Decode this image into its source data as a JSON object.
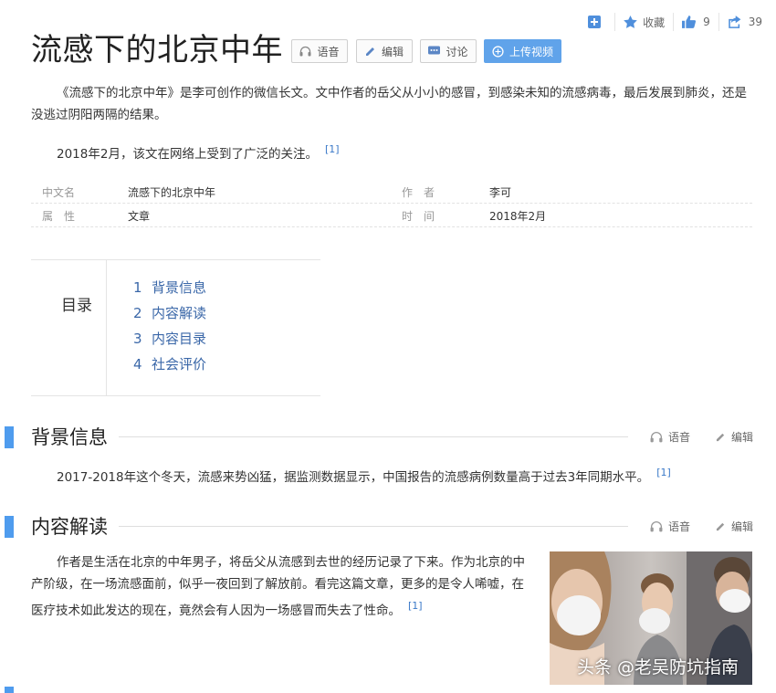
{
  "toolbar": {
    "collect_label": "收藏",
    "like_count": "9",
    "share_count": "39"
  },
  "title": "流感下的北京中年",
  "title_buttons": {
    "voice": "语音",
    "edit": "编辑",
    "discuss": "讨论",
    "upload_video": "上传视频"
  },
  "intro": {
    "p1": "《流感下的北京中年》是李可创作的微信长文。文中作者的岳父从小小的感冒，到感染未知的流感病毒，最后发展到肺炎，还是没逃过阴阳两隔的结果。",
    "p2": "2018年2月，该文在网络上受到了广泛的关注。",
    "p2_ref": "[1]"
  },
  "basic_info": [
    {
      "l1": "中文名",
      "v1": "流感下的北京中年",
      "l2": "作　者",
      "v2": "李可"
    },
    {
      "l1": "属　性",
      "v1": "文章",
      "l2": "时　间",
      "v2": "2018年2月"
    }
  ],
  "toc": {
    "title": "目录",
    "items": [
      {
        "num": "1",
        "label": "背景信息"
      },
      {
        "num": "2",
        "label": "内容解读"
      },
      {
        "num": "3",
        "label": "内容目录"
      },
      {
        "num": "4",
        "label": "社会评价"
      }
    ]
  },
  "sections": [
    {
      "title": "背景信息",
      "voice": "语音",
      "edit": "编辑",
      "text": "2017-2018年这个冬天，流感来势凶猛，据监测数据显示，中国报告的流感病例数量高于过去3年同期水平。",
      "ref": "[1]"
    },
    {
      "title": "内容解读",
      "voice": "语音",
      "edit": "编辑",
      "text": "作者是生活在北京的中年男子，将岳父从流感到去世的经历记录了下来。作为北京的中产阶级，在一场流感面前，似乎一夜回到了解放前。看完这篇文章，更多的是令人唏嘘，在医疗技术如此发达的现在，竟然会有人因为一场感冒而失去了性命。",
      "ref": "[1]"
    }
  ],
  "watermark": "头条 @老吴防坑指南",
  "colors": {
    "accent_blue": "#4f9cee",
    "link_blue": "#3a67a8",
    "button_blue": "#60a3ea"
  }
}
